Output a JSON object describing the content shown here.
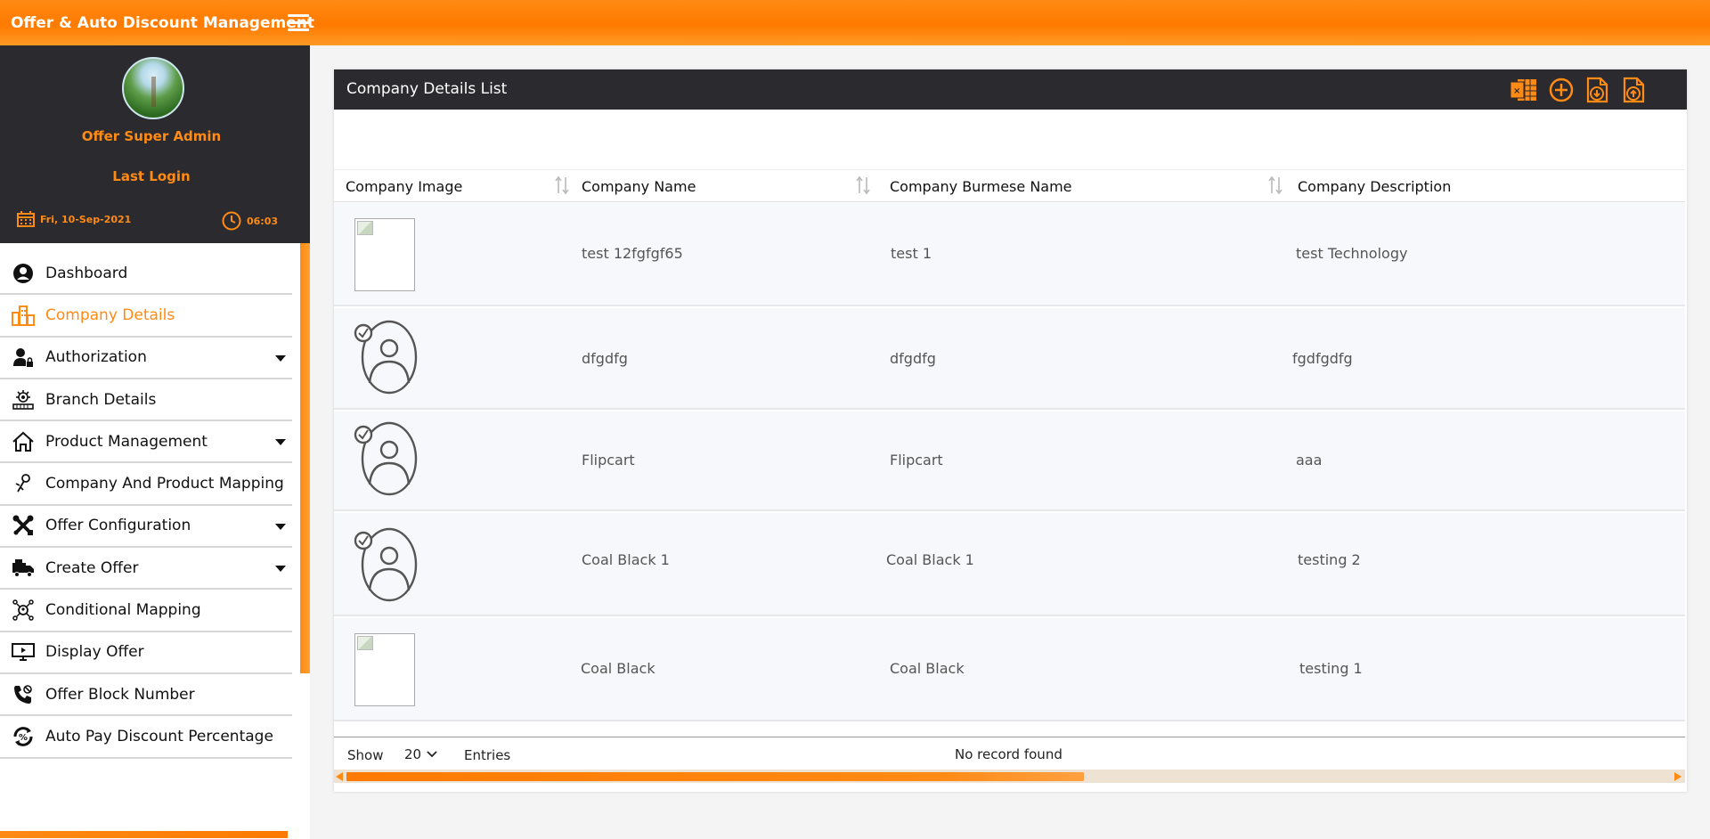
{
  "app": {
    "title": "Offer & Auto Discount Management"
  },
  "profile": {
    "name": "Offer Super Admin",
    "last_login_label": "Last Login",
    "date": "Fri, 10-Sep-2021",
    "time": "06:03"
  },
  "sidebar": {
    "items": [
      {
        "label": "Dashboard",
        "icon": "user-circle-icon",
        "active": false,
        "has_submenu": false
      },
      {
        "label": "Company Details",
        "icon": "buildings-icon",
        "active": true,
        "has_submenu": false
      },
      {
        "label": "Authorization",
        "icon": "user-lock-icon",
        "active": false,
        "has_submenu": true
      },
      {
        "label": "Branch Details",
        "icon": "branch-network-icon",
        "active": false,
        "has_submenu": false
      },
      {
        "label": "Product Management",
        "icon": "home-icon",
        "active": false,
        "has_submenu": true
      },
      {
        "label": "Company And Product Mapping",
        "icon": "pin-mapping-icon",
        "active": false,
        "has_submenu": false
      },
      {
        "label": "Offer Configuration",
        "icon": "tools-icon",
        "active": false,
        "has_submenu": true
      },
      {
        "label": "Create Offer",
        "icon": "truck-icon",
        "active": false,
        "has_submenu": true
      },
      {
        "label": "Conditional Mapping",
        "icon": "mapping-icon",
        "active": false,
        "has_submenu": false
      },
      {
        "label": "Display Offer",
        "icon": "monitor-icon",
        "active": false,
        "has_submenu": false
      },
      {
        "label": "Offer Block Number",
        "icon": "phone-block-icon",
        "active": false,
        "has_submenu": false
      },
      {
        "label": "Auto Pay Discount Percentage",
        "icon": "percent-cycle-icon",
        "active": false,
        "has_submenu": false
      }
    ]
  },
  "panel": {
    "title": "Company Details List",
    "tools": [
      "excel-export-icon",
      "add-circle-icon",
      "download-file-icon",
      "upload-file-icon"
    ]
  },
  "table": {
    "columns": [
      "Company Image",
      "Company Name",
      "Company Burmese Name",
      "Company Description"
    ],
    "rows": [
      {
        "image": "broken",
        "name": "test 12fgfgf65",
        "burmese_name": "test 1",
        "description": "test Technology"
      },
      {
        "image": "person",
        "name": "dfgdfg",
        "burmese_name": "dfgdfg",
        "description": "fgdfgdfg"
      },
      {
        "image": "person",
        "name": "Flipcart",
        "burmese_name": "Flipcart",
        "description": "aaa"
      },
      {
        "image": "person",
        "name": "Coal Black 1",
        "burmese_name": "Coal Black 1",
        "description": "testing 2"
      },
      {
        "image": "broken",
        "name": "Coal Black",
        "burmese_name": "Coal Black",
        "description": "testing 1"
      }
    ]
  },
  "footer": {
    "show_label": "Show",
    "page_size": "20",
    "entries_label": "Entries",
    "status": "No record found"
  },
  "colors": {
    "accent": "#ff8a14",
    "header_dark": "#2b2a2f"
  }
}
